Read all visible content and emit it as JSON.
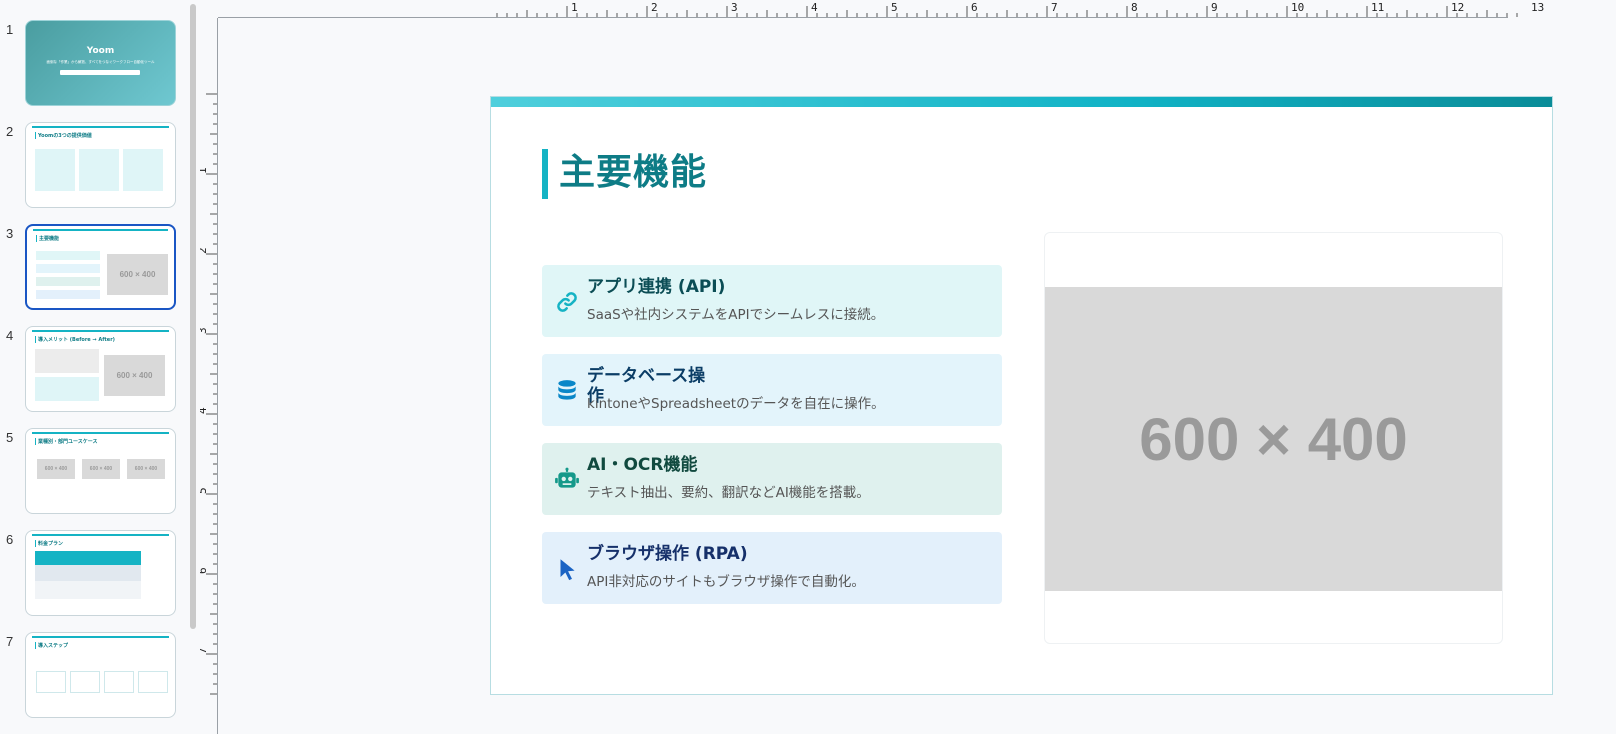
{
  "thumbnails": [
    {
      "num": "1",
      "title": "Yoom",
      "subtitle": "面倒な「作業」から解放、すべてをつなぐワークフロー自動化ツール"
    },
    {
      "num": "2",
      "title": "Yoomの3つの提供価値"
    },
    {
      "num": "3",
      "title": "主要機能",
      "placeholder": "600 × 400"
    },
    {
      "num": "4",
      "title": "導入メリット (Before → After)",
      "placeholder": "600 × 400"
    },
    {
      "num": "5",
      "title": "業種別・部門ユースケース",
      "placeholder": "600 × 400"
    },
    {
      "num": "6",
      "title": "料金プラン"
    },
    {
      "num": "7",
      "title": "導入ステップ"
    }
  ],
  "selected_slide": "3",
  "ruler": {
    "horizontal": [
      "1",
      "2",
      "3",
      "4",
      "5",
      "6",
      "7",
      "8",
      "9",
      "10",
      "11",
      "12",
      "13"
    ],
    "vertical": [
      "1",
      "2",
      "3",
      "4",
      "5",
      "6",
      "7"
    ]
  },
  "slide": {
    "title": "主要機能",
    "features": [
      {
        "icon": "link-icon",
        "title": "アプリ連携 (API)",
        "desc": "SaaSや社内システムをAPIでシームレスに接続。",
        "bg": "#e0f6f7",
        "color": "#0b4d55",
        "icon_color": "#15b3c4"
      },
      {
        "icon": "database-icon",
        "title": "データベース操作",
        "desc": "kintoneやSpreadsheetのデータを自在に操作。",
        "bg": "#e3f4fb",
        "color": "#0b3d66",
        "icon_color": "#0a87c8"
      },
      {
        "icon": "robot-icon",
        "title": "AI・OCR機能",
        "desc": "テキスト抽出、要約、翻訳などAI機能を搭載。",
        "bg": "#dff1ee",
        "color": "#114a3f",
        "icon_color": "#15998a"
      },
      {
        "icon": "cursor-icon",
        "title": "ブラウザ操作 (RPA)",
        "desc": "API非対応のサイトもブラウザ操作で自動化。",
        "bg": "#e3f0fb",
        "color": "#16306a",
        "icon_color": "#1a63c4"
      }
    ],
    "image_placeholder": "600 × 400"
  }
}
